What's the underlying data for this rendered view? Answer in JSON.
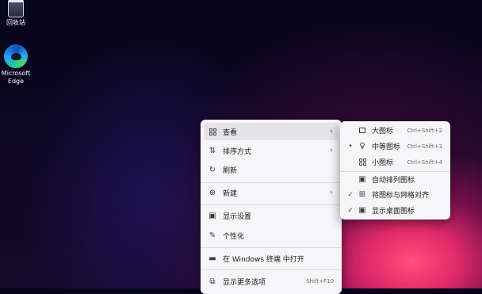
{
  "desktop": {
    "icons": [
      {
        "label": "回收站",
        "icon": "recycle-bin-icon"
      },
      {
        "label": "Microsoft Edge",
        "label_line1": "Microsoft",
        "label_line2": "Edge",
        "icon": "edge-icon"
      }
    ]
  },
  "context_menu": {
    "items": [
      {
        "label": "查看",
        "icon": "view-grid-icon",
        "submenu": true
      },
      {
        "label": "排序方式",
        "icon": "sort-icon",
        "submenu": true
      },
      {
        "label": "刷新",
        "icon": "refresh-icon"
      },
      {
        "label": "新建",
        "icon": "new-icon",
        "submenu": true
      },
      {
        "label": "显示设置",
        "icon": "display-settings-icon"
      },
      {
        "label": "个性化",
        "icon": "personalize-icon"
      },
      {
        "label": "在 Windows 终端 中打开",
        "icon": "terminal-icon"
      },
      {
        "label": "显示更多选项",
        "icon": "more-options-icon",
        "shortcut": "Shift+F10"
      }
    ]
  },
  "view_submenu": {
    "items": [
      {
        "label": "大图标",
        "shortcut": "Ctrl+Shift+2",
        "icon": "large-icons-icon",
        "mark": ""
      },
      {
        "label": "中等图标",
        "shortcut": "Ctrl+Shift+3",
        "icon": "medium-icons-icon",
        "mark": "•"
      },
      {
        "label": "小图标",
        "shortcut": "Ctrl+Shift+4",
        "icon": "small-icons-icon",
        "mark": ""
      },
      {
        "label": "自动排列图标",
        "icon": "auto-arrange-icon",
        "mark": ""
      },
      {
        "label": "将图标与网格对齐",
        "icon": "align-grid-icon",
        "mark": "✓"
      },
      {
        "label": "显示桌面图标",
        "icon": "show-desktop-icons-icon",
        "mark": "✓"
      }
    ]
  }
}
